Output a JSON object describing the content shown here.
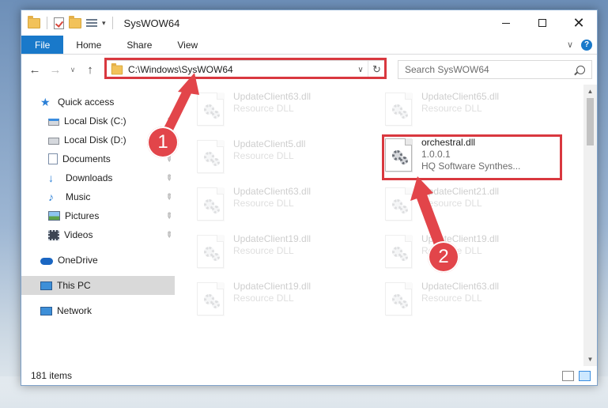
{
  "window": {
    "title": "SysWOW64",
    "controls": {
      "minimize": "–",
      "maximize": "□",
      "close": "✕"
    }
  },
  "ribbon": {
    "tabs": [
      "File",
      "Home",
      "Share",
      "View"
    ],
    "help": "?"
  },
  "address_bar": {
    "path": "C:\\Windows\\SysWOW64",
    "search_placeholder": "Search SysWOW64"
  },
  "nav_pane": {
    "items": [
      {
        "label": "Quick access",
        "icon": "star-icon",
        "pinned": false
      },
      {
        "label": "Local Disk (C:)",
        "icon": "drive-icon",
        "pinned": true
      },
      {
        "label": "Local Disk (D:)",
        "icon": "drive-icon",
        "pinned": true
      },
      {
        "label": "Documents",
        "icon": "documents-icon",
        "pinned": true
      },
      {
        "label": "Downloads",
        "icon": "download-icon",
        "pinned": true
      },
      {
        "label": "Music",
        "icon": "music-icon",
        "pinned": true
      },
      {
        "label": "Pictures",
        "icon": "pictures-icon",
        "pinned": true
      },
      {
        "label": "Videos",
        "icon": "videos-icon",
        "pinned": true
      },
      {
        "label": "OneDrive",
        "icon": "cloud-icon",
        "pinned": false
      },
      {
        "label": "This PC",
        "icon": "computer-icon",
        "pinned": false,
        "selected": true
      },
      {
        "label": "Network",
        "icon": "network-icon",
        "pinned": false
      }
    ]
  },
  "files": [
    {
      "name": "UpdateClient63.dll",
      "type": "Resource DLL",
      "faded": true
    },
    {
      "name": "UpdateClient65.dll",
      "type": "Resource DLL",
      "faded": true
    },
    {
      "name": "UpdateClient5.dll",
      "type": "Resource DLL",
      "faded": true
    },
    {
      "name": "orchestral.dll",
      "version": "1.0.0.1",
      "company": "HQ Software Synthes...",
      "faded": false,
      "highlighted": true
    },
    {
      "name": "UpdateClient63.dll",
      "type": "Resource DLL",
      "faded": true
    },
    {
      "name": "UpdateClient21.dll",
      "type": "Resource DLL",
      "faded": true
    },
    {
      "name": "UpdateClient19.dll",
      "type": "Resource DLL",
      "faded": true
    },
    {
      "name": "UpdateClient19.dll",
      "type": "Resource DLL",
      "faded": true
    },
    {
      "name": "UpdateClient19.dll",
      "type": "Resource DLL",
      "faded": true
    },
    {
      "name": "UpdateClient63.dll",
      "type": "Resource DLL",
      "faded": true
    }
  ],
  "annotations": {
    "step1": "1",
    "step2": "2",
    "color": "#e2454a"
  },
  "status_bar": {
    "item_count": "181 items"
  },
  "colors": {
    "accent": "#1979ca",
    "selection": "#cce8ff",
    "annotation_red": "#d9383f"
  }
}
